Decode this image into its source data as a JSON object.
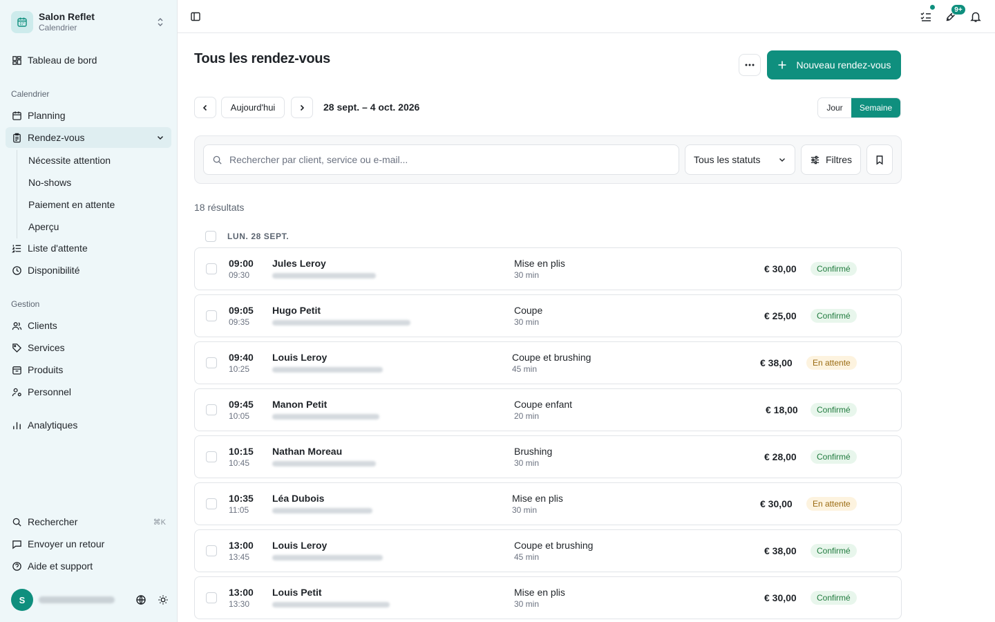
{
  "brand": {
    "name": "Salon Reflet",
    "sub": "Calendrier"
  },
  "sidebar": {
    "dashboard": "Tableau de bord",
    "section_calendar": "Calendrier",
    "planning": "Planning",
    "appointments": "Rendez-vous",
    "sub_items": [
      "Nécessite attention",
      "No-shows",
      "Paiement en attente",
      "Aperçu"
    ],
    "waitlist": "Liste d'attente",
    "availability": "Disponibilité",
    "section_management": "Gestion",
    "clients": "Clients",
    "services": "Services",
    "products": "Produits",
    "staff": "Personnel",
    "analytics": "Analytiques",
    "search": "Rechercher",
    "search_shortcut": "⌘K",
    "feedback": "Envoyer un retour",
    "help": "Aide et support",
    "avatar_initial": "S"
  },
  "topbar": {
    "notif_badge": "9+"
  },
  "header": {
    "title": "Tous les rendez-vous",
    "new_button": "Nouveau rendez-vous",
    "today": "Aujourd'hui",
    "date_range": "28 sept. – 4 oct. 2026",
    "view_day": "Jour",
    "view_week": "Semaine"
  },
  "filters": {
    "search_placeholder": "Rechercher par client, service ou e-mail...",
    "status": "Tous les statuts",
    "filters_label": "Filtres"
  },
  "results": "18 résultats",
  "group_label": "LUN. 28 SEPT.",
  "appointments": [
    {
      "start": "09:00",
      "end": "09:30",
      "name": "Jules Leroy",
      "service": "Mise en plis",
      "duration": "30 min",
      "price": "€ 30,00",
      "status": "Confirmé"
    },
    {
      "start": "09:05",
      "end": "09:35",
      "name": "Hugo Petit",
      "service": "Coupe",
      "duration": "30 min",
      "price": "€ 25,00",
      "status": "Confirmé"
    },
    {
      "start": "09:40",
      "end": "10:25",
      "name": "Louis Leroy",
      "service": "Coupe et brushing",
      "duration": "45 min",
      "price": "€ 38,00",
      "status": "En attente"
    },
    {
      "start": "09:45",
      "end": "10:05",
      "name": "Manon Petit",
      "service": "Coupe enfant",
      "duration": "20 min",
      "price": "€ 18,00",
      "status": "Confirmé"
    },
    {
      "start": "10:15",
      "end": "10:45",
      "name": "Nathan Moreau",
      "service": "Brushing",
      "duration": "30 min",
      "price": "€ 28,00",
      "status": "Confirmé"
    },
    {
      "start": "10:35",
      "end": "11:05",
      "name": "Léa Dubois",
      "service": "Mise en plis",
      "duration": "30 min",
      "price": "€ 30,00",
      "status": "En attente"
    },
    {
      "start": "13:00",
      "end": "13:45",
      "name": "Louis Leroy",
      "service": "Coupe et brushing",
      "duration": "45 min",
      "price": "€ 38,00",
      "status": "Confirmé"
    },
    {
      "start": "13:00",
      "end": "13:30",
      "name": "Louis Petit",
      "service": "Mise en plis",
      "duration": "30 min",
      "price": "€ 30,00",
      "status": "Confirmé"
    }
  ],
  "colors": {
    "accent": "#0f8f7e",
    "sidebar_bg": "#eef7f9",
    "confirmed_bg": "#e8f6ec",
    "pending_bg": "#fdf3df"
  }
}
